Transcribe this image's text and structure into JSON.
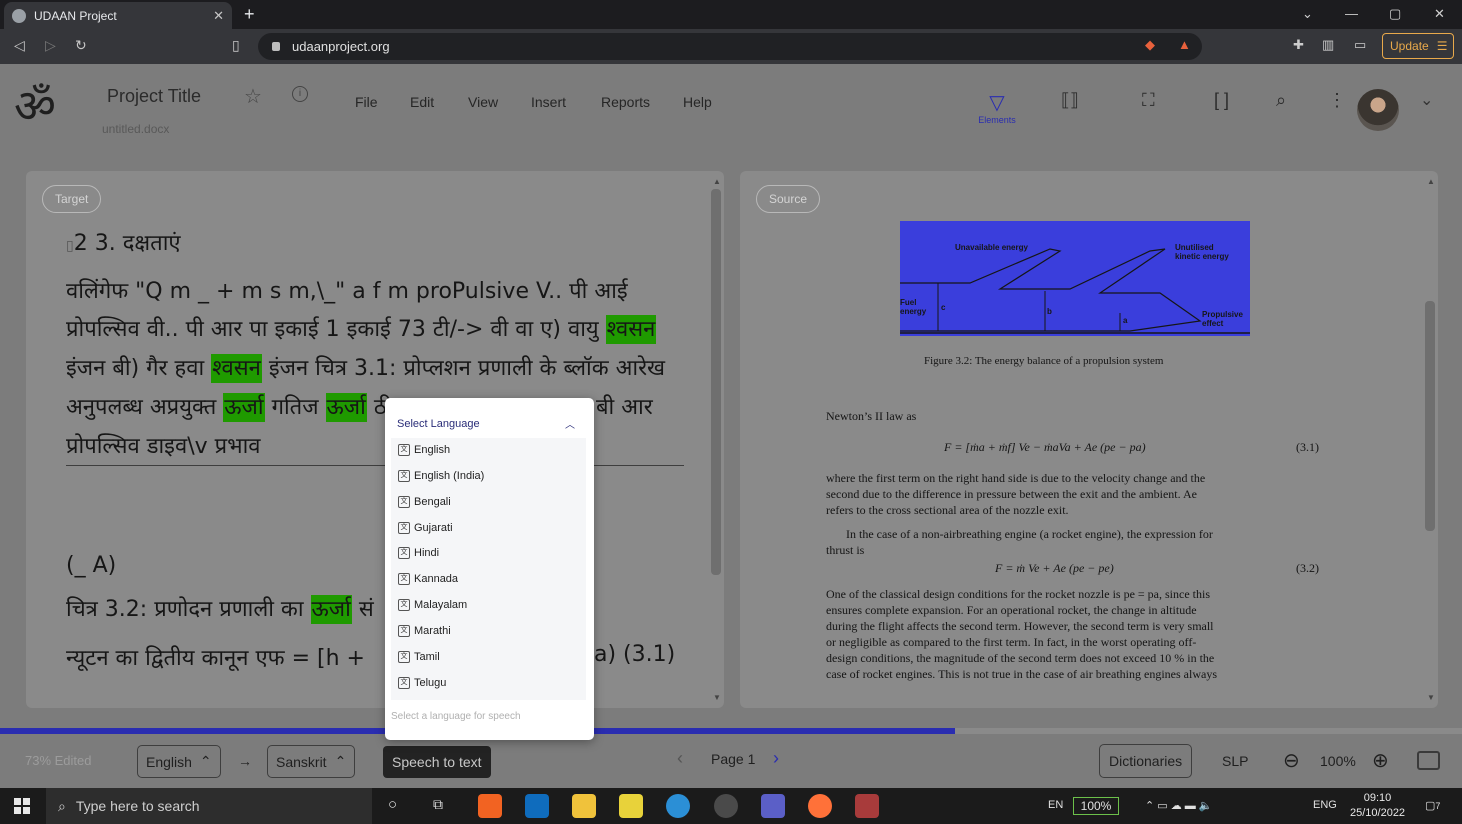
{
  "browser": {
    "tab_title": "UDAAN Project",
    "tab_close": "✕",
    "new_tab": "+",
    "url": "udaanproject.org",
    "update_label": "Update",
    "window_controls": [
      "⌄",
      "—",
      "▢",
      "✕"
    ]
  },
  "header": {
    "logo": "ॐ",
    "project_title": "Project Title",
    "file_name": "untitled.docx",
    "menu": [
      "File",
      "Edit",
      "View",
      "Insert",
      "Reports",
      "Help"
    ],
    "elements_label": "Elements"
  },
  "target": {
    "pill": "Target",
    "lines": [
      "2 3. दक्षताएं",
      "वलिंगेफ \"Q m _ + m s m,\\_\" a f m proPulsive V.. पी आई",
      "प्रोपल्सिव वी.. पी आर पा इकाई 1 इकाई 73 टी/-> वी वा ए) वायु",
      "इंजन बी) गैर हवा",
      "इंजन चित्र 3.1: प्रोप्लशन प्रणाली के ब्लॉक आरेख",
      "अनुपलब्ध अप्रयुक्त",
      "गतिज",
      "ठी",
      "बी आर",
      "प्रोपल्सिव डाइव\\v प्रभाव",
      "(_ A)",
      "चित्र 3.2: प्रणोदन प्रणाली का",
      "सं",
      "न्यूटन का द्वितीय कानून एफ = [h +",
      "a) (3.1)"
    ],
    "highlights": [
      "श्वसन",
      "श्वसन",
      "ऊर्जा",
      "ऊर्जा",
      "ऊर्जा"
    ]
  },
  "source": {
    "pill": "Source",
    "diagram_labels": [
      "Unavailable energy",
      "Unutilised kinetic energy",
      "Fuel energy",
      "Propulsive effect",
      "c",
      "b",
      "a"
    ],
    "figure_caption": "Figure 3.2: The energy balance of a propulsion system",
    "text": [
      "Newton’s II law as",
      "F = [ṁa + ṁf] Ve − ṁaVa + Ae (pe − pa)",
      "(3.1)",
      "where the first term on the right hand side is due to the velocity change and the",
      "second due to the difference in pressure between the exit and the ambient.  Ae",
      "refers to the cross sectional area of the nozzle exit.",
      "In the case of a non-airbreathing engine (a rocket engine), the expression for",
      "thrust is",
      "F = ṁ Ve + Ae (pe − pe)",
      "(3.2)",
      "One of the classical design conditions for the rocket nozzle is pe = pa, since this",
      "ensures complete expansion.  For an operational rocket, the change in altitude",
      "during the flight affects the second term. However, the second term is very small",
      "or negligible as compared to the first term.  In fact, in the worst operating off-",
      "design conditions, the magnitude of the second term does not exceed 10 % in the",
      "case of rocket engines.  This is not true in the case of air breathing engines always"
    ]
  },
  "dropdown": {
    "header": "Select Language",
    "options": [
      "English",
      "English (India)",
      "Bengali",
      "Gujarati",
      "Hindi",
      "Kannada",
      "Malayalam",
      "Marathi",
      "Tamil",
      "Telugu"
    ],
    "footer": "Select a language for speech"
  },
  "bottom": {
    "edited": "73% Edited",
    "progress": 0.653,
    "source_lang": "English",
    "arrow": "→",
    "target_lang": "Sanskrit",
    "speech_btn": "Speech to text",
    "page": "Page 1",
    "dictionaries": "Dictionaries",
    "slp": "SLP",
    "zoom": "100%"
  },
  "taskbar": {
    "search_placeholder": "Type here to search",
    "lang": "EN",
    "battery": "100%",
    "kbd": "ENG",
    "time": "09:10",
    "date": "25/10/2022",
    "notif_count": "7"
  },
  "colors": {
    "accent": "#2a2db0",
    "highlight": "#1f9a00",
    "update": "#e8a94b"
  }
}
